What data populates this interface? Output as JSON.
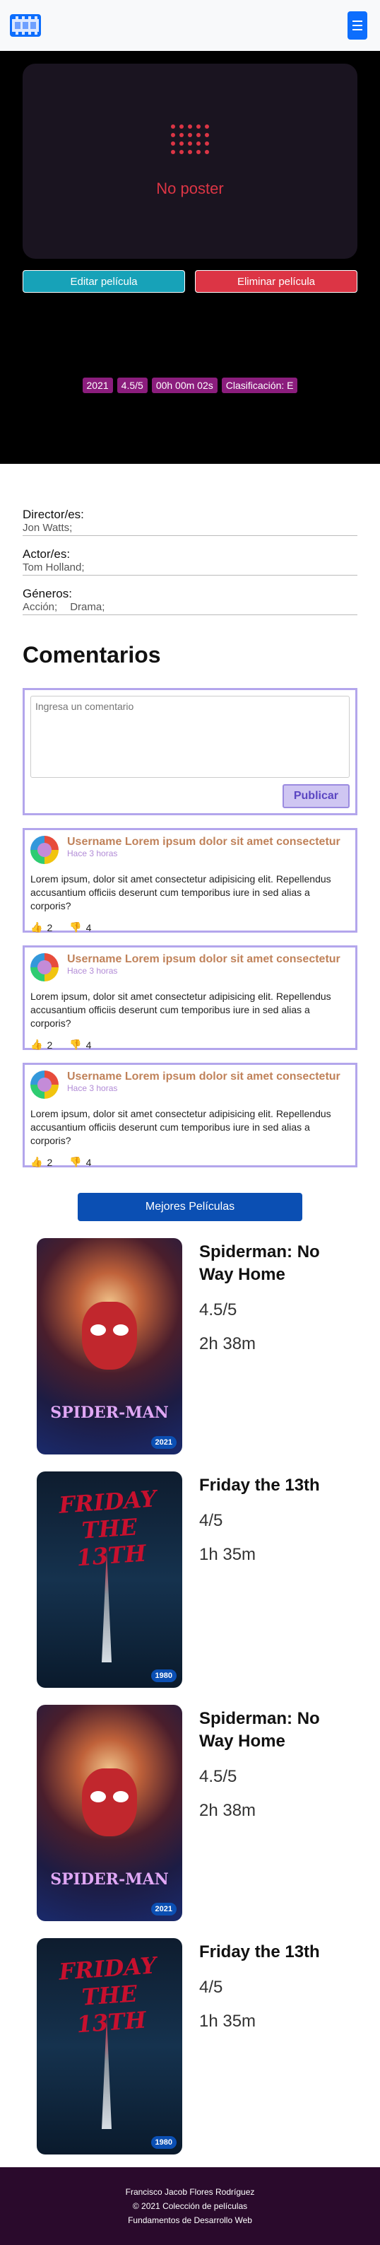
{
  "navbar": {
    "brand_icon": "film-icon",
    "toggle_icon": "menu-icon"
  },
  "hero": {
    "no_poster": "No poster",
    "edit_label": "Editar película",
    "delete_label": "Eliminar película",
    "badges": [
      "2021",
      "4.5/5",
      "00h 00m 02s",
      "Clasificación: E"
    ]
  },
  "info": {
    "director_label": "Director/es:",
    "director_value": "Jon Watts;",
    "actors_label": "Actor/es:",
    "actors_value": "Tom Holland;",
    "genres_label": "Géneros:",
    "genres": [
      "Acción;",
      "Drama;"
    ]
  },
  "comments": {
    "title": "Comentarios",
    "placeholder": "Ingresa un comentario",
    "publish_label": "Publicar",
    "items": [
      {
        "user": "Username Lorem ipsum dolor sit amet consectetur",
        "time": "Hace 3 horas",
        "text": "Lorem ipsum, dolor sit amet consectetur adipisicing elit. Repellendus accusantium officiis deserunt cum temporibus iure in sed alias a corporis?",
        "likes": "2",
        "dislikes": "4"
      },
      {
        "user": "Username Lorem ipsum dolor sit amet consectetur",
        "time": "Hace 3 horas",
        "text": "Lorem ipsum, dolor sit amet consectetur adipisicing elit. Repellendus accusantium officiis deserunt cum temporibus iure in sed alias a corporis?",
        "likes": "2",
        "dislikes": "4"
      },
      {
        "user": "Username Lorem ipsum dolor sit amet consectetur",
        "time": "Hace 3 horas",
        "text": "Lorem ipsum, dolor sit amet consectetur adipisicing elit. Repellendus accusantium officiis deserunt cum temporibus iure in sed alias a corporis?",
        "likes": "2",
        "dislikes": "4"
      }
    ]
  },
  "best": {
    "label": "Mejores Películas",
    "movies": [
      {
        "title": "Spiderman: No Way Home",
        "rating": "4.5/5",
        "duration": "2h 38m",
        "year": "2021",
        "poster_title": "SPIDER-MAN"
      },
      {
        "title": "Friday the 13th",
        "rating": "4/5",
        "duration": "1h 35m",
        "year": "1980",
        "poster_title": "FRIDAY THE 13TH"
      },
      {
        "title": "Spiderman: No Way Home",
        "rating": "4.5/5",
        "duration": "2h 38m",
        "year": "2021",
        "poster_title": "SPIDER-MAN"
      },
      {
        "title": "Friday the 13th",
        "rating": "4/5",
        "duration": "1h 35m",
        "year": "1980",
        "poster_title": "FRIDAY THE 13TH"
      }
    ]
  },
  "footer": {
    "line1": "Francisco Jacob Flores Rodríguez",
    "line2": "© 2021 Colección de películas",
    "line3": "Fundamentos de Desarrollo Web"
  },
  "colors": {
    "primary": "#0d6efd",
    "danger": "#dc3545",
    "info": "#17a2b8",
    "badge": "#8b1d7d",
    "footer": "#2a0a2c"
  }
}
